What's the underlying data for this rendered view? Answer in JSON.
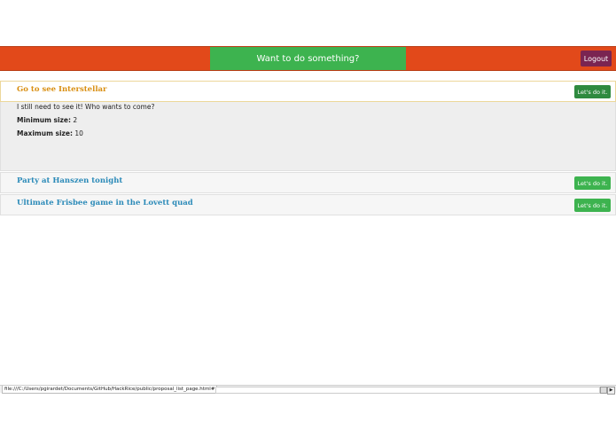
{
  "navbar": {
    "cta_label": "Want to do something?",
    "logout_label": "Logout",
    "colors": {
      "bar": "#e2491a",
      "cta": "#3db34f",
      "logout": "#7a2451"
    }
  },
  "proposals": [
    {
      "title": "Go to see Interstellar",
      "button_label": "Let's do it.",
      "expanded": true,
      "description": "I still need to see it! Who wants to come?",
      "min_label": "Minimum size:",
      "min_value": "2",
      "max_label": "Maximum size:",
      "max_value": "10"
    },
    {
      "title": "Party at Hanszen tonight",
      "button_label": "Let's do it."
    },
    {
      "title": "Ultimate Frisbee game in the Lovett quad",
      "button_label": "Let's do it."
    }
  ],
  "statusbar": {
    "url": "file:///C:/Users/pgirardet/Documents/GitHub/HackRice/public/proposal_list_page.html#"
  }
}
